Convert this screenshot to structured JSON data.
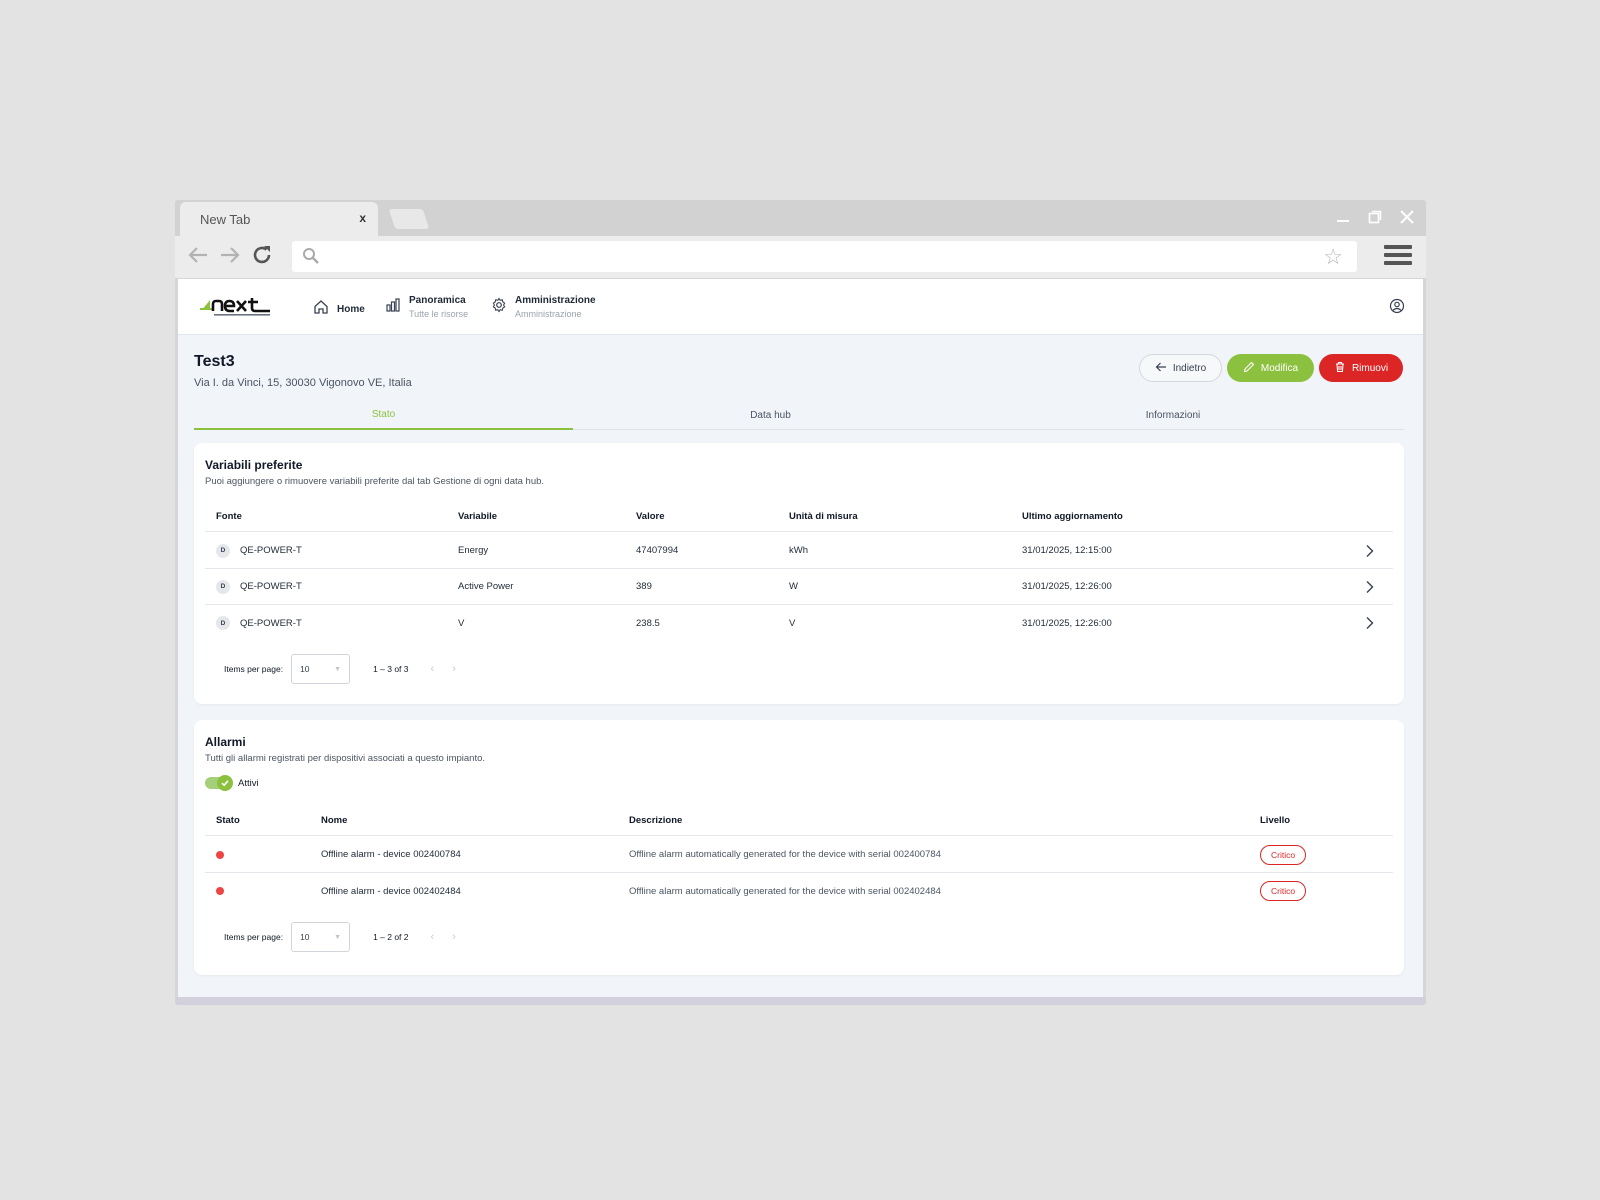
{
  "browser": {
    "tab_title": "New Tab",
    "tab_close": "x"
  },
  "app": {
    "nav": [
      {
        "title": "Home",
        "subtitle": ""
      },
      {
        "title": "Panoramica",
        "subtitle": "Tutte le risorse"
      },
      {
        "title": "Amministrazione",
        "subtitle": "Amministrazione"
      }
    ]
  },
  "page": {
    "title": "Test3",
    "address": "Via I. da Vinci, 15, 30030 Vigonovo VE, Italia",
    "actions": {
      "back": "Indietro",
      "edit": "Modifica",
      "remove": "Rimuovi"
    },
    "tabs": [
      "Stato",
      "Data hub",
      "Informazioni"
    ],
    "active_tab": "Stato"
  },
  "favorites": {
    "title": "Variabili preferite",
    "subtitle": "Puoi aggiungere o rimuovere variabili preferite dal tab Gestione di ogni data hub.",
    "columns": [
      "Fonte",
      "Variabile",
      "Valore",
      "Unità di misura",
      "Ultimo aggiornamento"
    ],
    "rows": [
      {
        "badge": "D",
        "source": "QE-POWER-T",
        "variable": "Energy",
        "value": "47407994",
        "unit": "kWh",
        "updated": "31/01/2025, 12:15:00"
      },
      {
        "badge": "D",
        "source": "QE-POWER-T",
        "variable": "Active Power",
        "value": "389",
        "unit": "W",
        "updated": "31/01/2025, 12:26:00"
      },
      {
        "badge": "D",
        "source": "QE-POWER-T",
        "variable": "V",
        "value": "238.5",
        "unit": "V",
        "updated": "31/01/2025, 12:26:00"
      }
    ],
    "pager": {
      "label": "Items per page:",
      "size": "10",
      "range": "1 – 3 of 3"
    }
  },
  "alarms": {
    "title": "Allarmi",
    "subtitle": "Tutti gli allarmi registrati per dispositivi associati a questo impianto.",
    "toggle_label": "Attivi",
    "columns": [
      "Stato",
      "Nome",
      "Descrizione",
      "Livello"
    ],
    "rows": [
      {
        "name": "Offline alarm - device 002400784",
        "description": "Offline alarm automatically generated for the device with serial 002400784",
        "level": "Critico"
      },
      {
        "name": "Offline alarm - device 002402484",
        "description": "Offline alarm automatically generated for the device with serial 002402484",
        "level": "Critico"
      }
    ],
    "pager": {
      "label": "Items per page:",
      "size": "10",
      "range": "1 – 2 of 2"
    }
  },
  "colors": {
    "accent": "#8cc13f",
    "danger": "#dc2626",
    "background": "#f1f4f8"
  }
}
